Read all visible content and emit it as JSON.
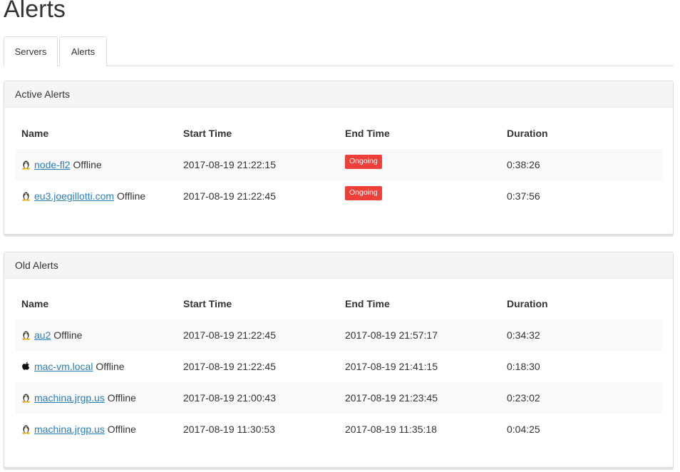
{
  "page": {
    "title": "Alerts"
  },
  "tabs": [
    {
      "label": "Servers"
    },
    {
      "label": "Alerts"
    }
  ],
  "active_alerts": {
    "title": "Active Alerts",
    "columns": [
      "Name",
      "Start Time",
      "End Time",
      "Duration"
    ],
    "rows": [
      {
        "os": "linux",
        "host": "node-fl2",
        "status": "Offline",
        "start": "2017-08-19 21:22:15",
        "end": "Ongoing",
        "duration": "0:38:26"
      },
      {
        "os": "linux",
        "host": "eu3.joegillotti.com",
        "status": "Offline",
        "start": "2017-08-19 21:22:45",
        "end": "Ongoing",
        "duration": "0:37:56"
      }
    ]
  },
  "old_alerts": {
    "title": "Old Alerts",
    "columns": [
      "Name",
      "Start Time",
      "End Time",
      "Duration"
    ],
    "rows": [
      {
        "os": "linux",
        "host": "au2",
        "status": "Offline",
        "start": "2017-08-19 21:22:45",
        "end": "2017-08-19 21:57:17",
        "duration": "0:34:32"
      },
      {
        "os": "apple",
        "host": "mac-vm.local",
        "status": "Offline",
        "start": "2017-08-19 21:22:45",
        "end": "2017-08-19 21:41:15",
        "duration": "0:18:30"
      },
      {
        "os": "linux",
        "host": "machina.jrgp.us",
        "status": "Offline",
        "start": "2017-08-19 21:00:43",
        "end": "2017-08-19 21:23:45",
        "duration": "0:23:02"
      },
      {
        "os": "linux",
        "host": "machina.jrgp.us",
        "status": "Offline",
        "start": "2017-08-19 11:30:53",
        "end": "2017-08-19 11:35:18",
        "duration": "0:04:25"
      }
    ]
  },
  "icons": {
    "linux": "linux-tux-icon",
    "apple": "apple-icon"
  },
  "colors": {
    "link": "#2a7eb6",
    "ongoing_badge": "#ee3f39"
  }
}
